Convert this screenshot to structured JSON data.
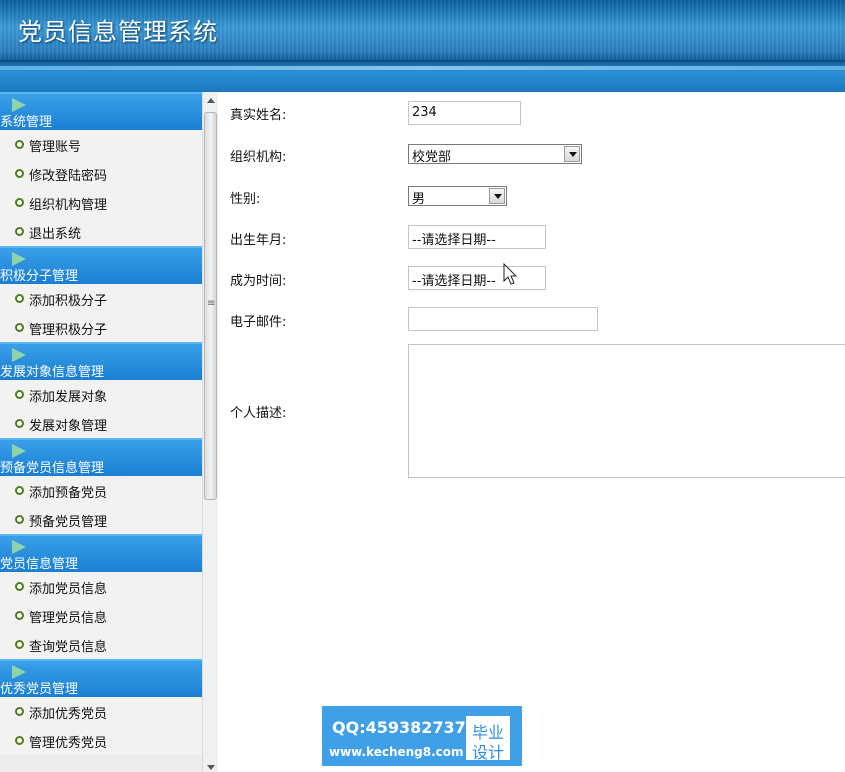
{
  "header": {
    "title": "党员信息管理系统"
  },
  "sidebar": {
    "groups": [
      {
        "title": "系统管理",
        "items": [
          "管理账号",
          "修改登陆密码",
          "组织机构管理",
          "退出系统"
        ]
      },
      {
        "title": "积极分子管理",
        "items": [
          "添加积极分子",
          "管理积极分子"
        ]
      },
      {
        "title": "发展对象信息管理",
        "items": [
          "添加发展对象",
          "发展对象管理"
        ]
      },
      {
        "title": "预备党员信息管理",
        "items": [
          "添加预备党员",
          "预备党员管理"
        ]
      },
      {
        "title": "党员信息管理",
        "items": [
          "添加党员信息",
          "管理党员信息",
          "查询党员信息"
        ]
      },
      {
        "title": "优秀党员管理",
        "items": [
          "添加优秀党员",
          "管理优秀党员"
        ]
      }
    ]
  },
  "form": {
    "real_name": {
      "label": "真实姓名:",
      "value": "234"
    },
    "organization": {
      "label": "组织机构:",
      "value": "校党部"
    },
    "gender": {
      "label": "性别:",
      "value": "男"
    },
    "birth_date": {
      "label": "出生年月:",
      "value": "--请选择日期--"
    },
    "join_date": {
      "label": "成为时间:",
      "value": "--请选择日期--"
    },
    "email": {
      "label": "电子邮件:",
      "value": ""
    },
    "description": {
      "label": "个人描述:",
      "value": ""
    }
  },
  "watermark": {
    "qq": "QQ:459382737",
    "site": "www.kecheng8.com",
    "badge_line1": "毕业",
    "badge_line2": "设计"
  },
  "colors": {
    "header": "#2b7fc0",
    "menu_header": "#2d93e0",
    "bullet": "#4a7d1c",
    "watermark": "#3fa0e8"
  }
}
